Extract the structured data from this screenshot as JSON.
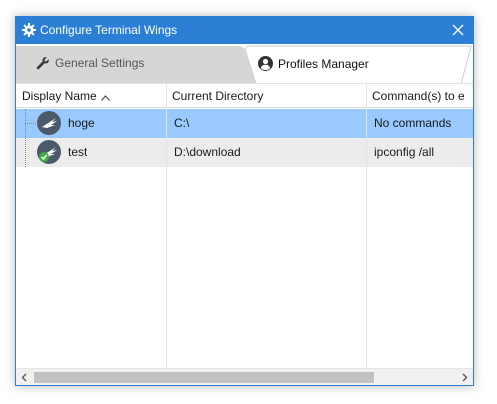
{
  "window": {
    "title": "Configure Terminal Wings",
    "title_icon": "gear-icon",
    "close_icon": "close-icon"
  },
  "tabs": [
    {
      "label": "General Settings",
      "icon": "wrench-icon",
      "active": false
    },
    {
      "label": "Profiles Manager",
      "icon": "user-circle-icon",
      "active": true
    }
  ],
  "grid": {
    "columns": [
      {
        "label": "Display Name",
        "sort": "ascending"
      },
      {
        "label": "Current Directory"
      },
      {
        "label": "Command(s) to e"
      }
    ],
    "rows": [
      {
        "name": "hoge",
        "directory": "C:\\",
        "commands": "No commands",
        "icon": "terminal-wings-icon",
        "selected": true
      },
      {
        "name": "test",
        "directory": "D:\\download",
        "commands": "ipconfig /all",
        "icon": "terminal-wings-check-icon",
        "selected": false
      }
    ]
  },
  "colors": {
    "titlebar": "#2b7fd4",
    "selection": "#99c9ff",
    "alt_row": "#ececec"
  }
}
